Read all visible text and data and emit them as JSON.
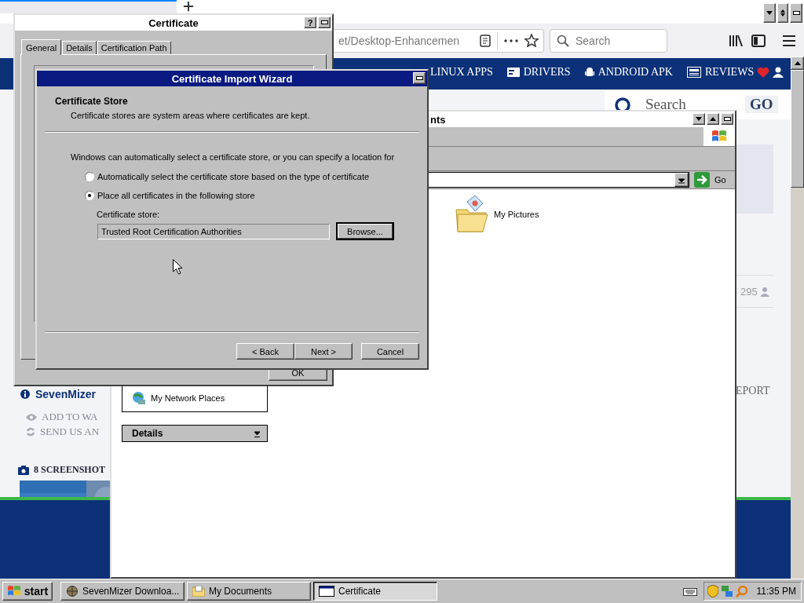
{
  "browser": {
    "address": "et/Desktop-Enhancemen",
    "search_placeholder": "Search",
    "site_nav": [
      {
        "label": "LINUX APPS"
      },
      {
        "label": "DRIVERS"
      },
      {
        "label": "ANDROID APK"
      },
      {
        "label": "REVIEWS"
      }
    ],
    "site_search": {
      "placeholder": "Search",
      "button": "GO"
    },
    "app_name": "SevenMizer",
    "actions": [
      {
        "label": "ADD TO WA"
      },
      {
        "label": "SEND US AN"
      }
    ],
    "screenshots": "8 SCREENSHOT",
    "count": "295",
    "report": "EPORT"
  },
  "explorer": {
    "title": "nts",
    "go": "Go",
    "folders": [
      {
        "label": "My Pictures"
      }
    ],
    "places": [
      {
        "label": "My Network Places"
      }
    ],
    "details": "Details"
  },
  "certificate": {
    "title": "Certificate",
    "help": "?",
    "tabs": [
      {
        "label": "General",
        "selected": true
      },
      {
        "label": "Details",
        "selected": false
      },
      {
        "label": "Certification Path",
        "selected": false
      }
    ],
    "ok": "OK"
  },
  "wizard": {
    "title": "Certificate Import Wizard",
    "heading": "Certificate Store",
    "subheading": "Certificate stores are system areas where certificates are kept.",
    "intro": "Windows can automatically select a certificate store, or you can specify a location for",
    "options": [
      {
        "label": "Automatically select the certificate store based on the type of certificate",
        "selected": false
      },
      {
        "label": "Place all certificates in the following store",
        "selected": true
      }
    ],
    "store_label": "Certificate store:",
    "store_value": "Trusted Root Certification Authorities",
    "browse": "Browse...",
    "buttons": [
      "< Back",
      "Next >",
      "Cancel"
    ]
  },
  "taskbar": {
    "start": "start",
    "tasks": [
      {
        "label": "SevenMizer Downloa...",
        "selected": false
      },
      {
        "label": "My Documents",
        "selected": false
      },
      {
        "label": "Certificate",
        "selected": true
      }
    ],
    "clock": "11:35 PM"
  }
}
